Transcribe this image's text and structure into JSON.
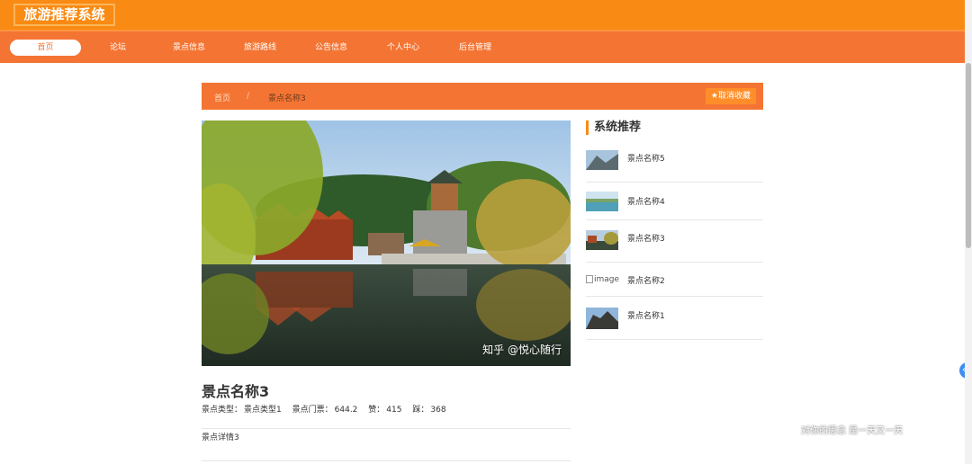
{
  "header": {
    "brand": "旅游推荐系统"
  },
  "nav": {
    "items": [
      {
        "label": "首页",
        "active": true
      },
      {
        "label": "论坛"
      },
      {
        "label": "景点信息"
      },
      {
        "label": "旅游路线"
      },
      {
        "label": "公告信息"
      },
      {
        "label": "个人中心"
      },
      {
        "label": "后台管理"
      }
    ]
  },
  "breadcrumb": {
    "home": "首页",
    "sep": "/",
    "current": "景点名称3"
  },
  "favorite": {
    "label": "取消收藏",
    "icon": "star-icon"
  },
  "photo": {
    "watermark": "知乎 @悦心随行"
  },
  "detail": {
    "title": "景点名称3",
    "type_label": "景点类型：",
    "type_value": "景点类型1",
    "ticket_label": "景点门票：",
    "ticket_value": "644.2",
    "like_label": "赞：",
    "like_value": "415",
    "dislike_label": "踩：",
    "dislike_value": "368",
    "description": "景点详情3"
  },
  "recommend": {
    "title": "系统推荐",
    "items": [
      {
        "name": "景点名称5"
      },
      {
        "name": "景点名称4"
      },
      {
        "name": "景点名称3"
      },
      {
        "name": "景点名称2",
        "broken_alt": "image"
      },
      {
        "name": "景点名称1"
      }
    ]
  },
  "floating": {
    "toggle_icon": "chevron-left-icon"
  },
  "slogan": "对你的思念 是一天又一天",
  "colors": {
    "brand": "#f98a13",
    "nav": "#f47533"
  }
}
